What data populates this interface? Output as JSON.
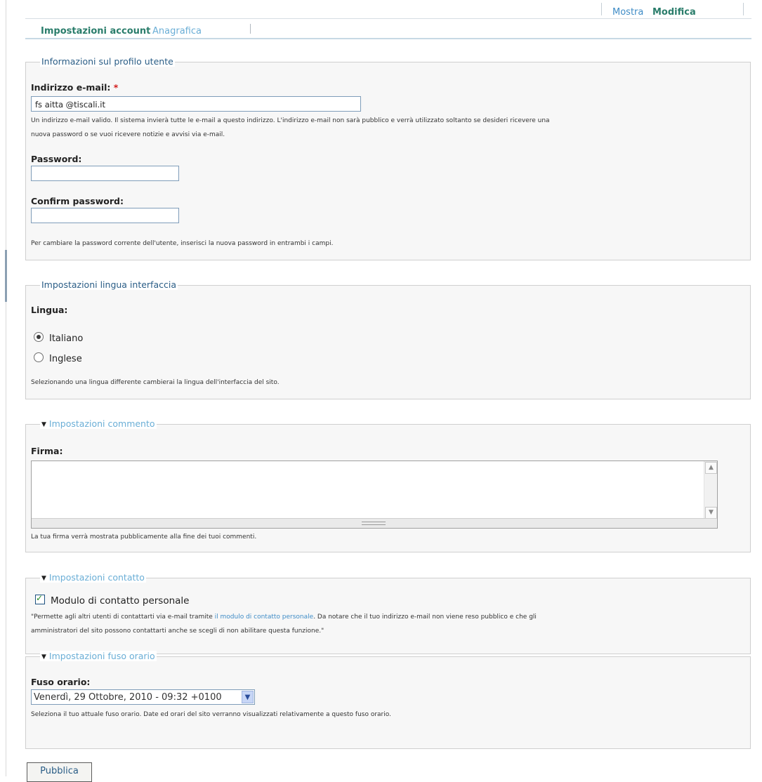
{
  "top_tabs": {
    "mostra": "Mostra",
    "modifica": "Modifica"
  },
  "sub_tabs": {
    "account": "Impostazioni account",
    "anagrafica": "Anagrafica"
  },
  "profile": {
    "legend": "Informazioni sul profilo utente",
    "email_label": "Indirizzo e-mail:",
    "required_mark": "*",
    "email_value": "fs aitta @tiscali.it",
    "email_help_1": "Un indirizzo e-mail valido. Il sistema invierà tutte le e-mail a questo indirizzo. L'indirizzo e-mail non sarà pubblico e verrà utilizzato soltanto se desideri ricevere una",
    "email_help_2": "nuova password o se vuoi ricevere notizie e avvisi via e-mail.",
    "password_label": "Password:",
    "confirm_label": "Confirm password:",
    "password_help": "Per cambiare la password corrente dell'utente, inserisci la nuova password in entrambi i campi."
  },
  "language": {
    "legend": "Impostazioni lingua interfaccia",
    "label": "Lingua:",
    "options": [
      "Italiano",
      "Inglese"
    ],
    "selected": "Italiano",
    "help": "Selezionando una lingua differente cambierai la lingua dell'interfaccia del sito."
  },
  "comment": {
    "legend": "Impostazioni commento",
    "label": "Firma:",
    "value": "",
    "help": "La tua firma verrà mostrata pubblicamente alla fine dei tuoi commenti."
  },
  "contact": {
    "legend": "Impostazioni contatto",
    "checkbox_label": "Modulo di contatto personale",
    "checked": true,
    "help_1a": "\"Permette agli altri utenti di contattarti via e-mail tramite ",
    "help_link": "il modulo di contatto personale",
    "help_1b": ". Da notare che il tuo indirizzo e-mail non viene reso pubblico e che gli",
    "help_2": "amministratori del sito possono contattarti anche se scegli di non abilitare questa funzione.\""
  },
  "timezone": {
    "legend": "Impostazioni fuso orario",
    "label": "Fuso orario:",
    "selected": "Venerdì, 29 Ottobre, 2010 - 09:32 +0100",
    "help": "Seleziona il tuo attuale fuso orario. Date ed orari del sito verranno visualizzati relativamente a questo fuso orario."
  },
  "submit_label": "Pubblica",
  "colors": {
    "link": "#3f8cc6",
    "active_tab": "#2a7d6b",
    "legend": "#2a5d86",
    "required": "#d21b1b"
  }
}
